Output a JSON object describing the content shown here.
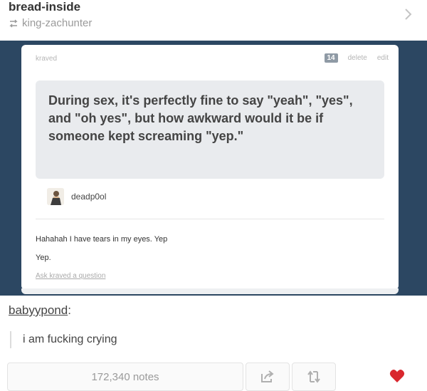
{
  "header": {
    "blog_name": "bread-inside",
    "reblogged_from": "king-zachunter"
  },
  "card": {
    "asker_blog": "kraved",
    "count": "14",
    "delete_label": "delete",
    "edit_label": "edit",
    "question": "During sex, it's perfectly fine to say \"yeah\", \"yes\", and \"oh yes\", but how awkward would it be if someone kept screaming \"yep.\"",
    "asker_name": "deadp0ol",
    "answer_line1": "Hahahah I have tears in my eyes. Yep",
    "answer_line2": "Yep.",
    "ask_link": "Ask kraved a question"
  },
  "comment": {
    "username": "babyypond",
    "colon": ":",
    "text": "i am fucking crying"
  },
  "footer": {
    "notes": "172,340 notes",
    "like_color": "#d9272e"
  },
  "colors": {
    "frame": "#2c4762",
    "question_bg": "#e9ebee"
  }
}
